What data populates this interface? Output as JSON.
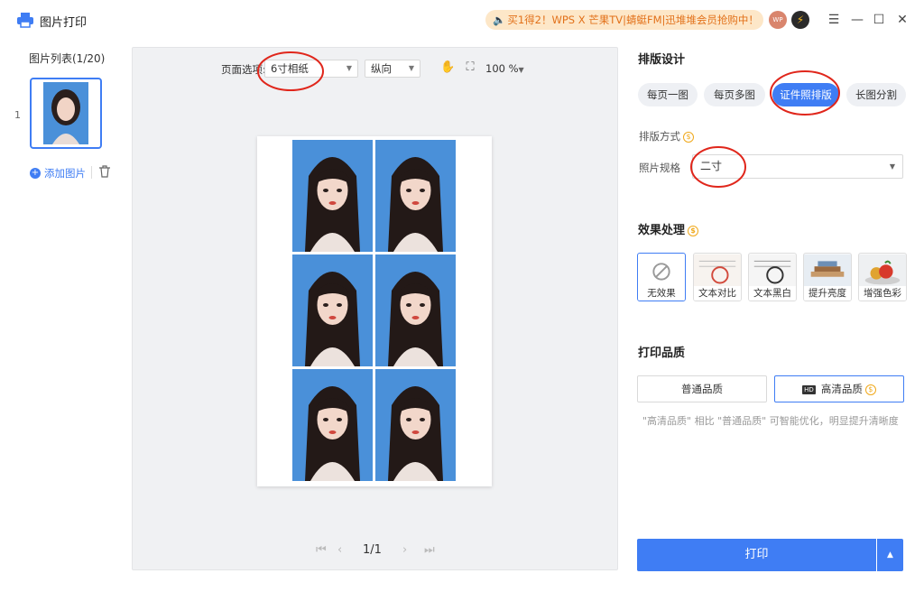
{
  "app": {
    "title": "图片打印",
    "user_initials": "WP"
  },
  "promo": {
    "text": "买1得2！WPS X 芒果TV|蜻蜓FM|迅堆堆会员抢购中！"
  },
  "colors": {
    "accent": "#3f7df4",
    "promo_bg": "#fde7c8",
    "promo_text": "#e2711a",
    "photo_bg": "#4a90d9"
  },
  "icons": [
    "printer-icon",
    "speaker-icon",
    "bolt-icon",
    "menu-icon",
    "minimize-icon",
    "maximize-icon",
    "close-icon",
    "plus-icon",
    "trash-icon",
    "hand-icon",
    "fit-icon",
    "coin-icon",
    "no-effect-icon"
  ],
  "sidebar": {
    "title": "图片列表(1/20)",
    "items": [
      {
        "index": "1"
      }
    ],
    "add_label": "添加图片"
  },
  "preview": {
    "page_option_label": "页面选项:",
    "paper_size": "6寸相纸",
    "orientation": "纵向",
    "zoom": "100 %",
    "page_indicator": "1/1"
  },
  "right": {
    "layout_title": "排版设计",
    "layout_tabs": [
      "每页一图",
      "每页多图",
      "证件照排版",
      "长图分割"
    ],
    "arrangement_label": "排版方式",
    "spec_label": "照片规格",
    "spec_value": "二寸",
    "effect_title": "效果处理",
    "effects": [
      "无效果",
      "文本对比",
      "文本黑白",
      "提升亮度",
      "增强色彩"
    ],
    "quality_title": "打印品质",
    "quality_normal": "普通品质",
    "quality_hd": "高清品质",
    "hd_badge": "HD",
    "quality_note": "\"高清品质\" 相比 \"普通品质\" 可智能优化，明显提升清晰度",
    "print_label": "打印"
  }
}
